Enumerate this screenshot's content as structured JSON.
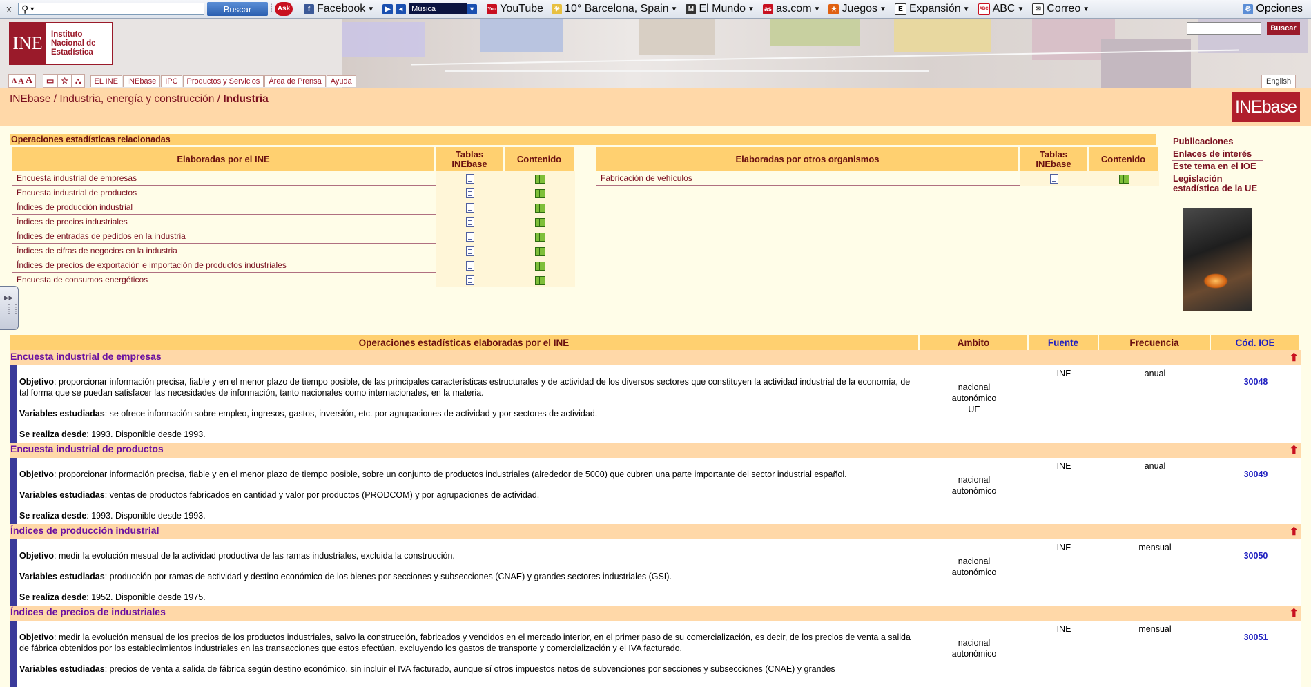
{
  "browser_toolbar": {
    "close": "x",
    "search_button": "Buscar",
    "items": [
      {
        "label": "Facebook",
        "icon": "facebook-icon"
      },
      {
        "label": "Música",
        "icon": "music-icon"
      },
      {
        "label": "YouTube",
        "icon": "youtube-icon"
      },
      {
        "label": "10° Barcelona, Spain",
        "icon": "weather-icon"
      },
      {
        "label": "El Mundo",
        "icon": "news-icon"
      },
      {
        "label": "as.com",
        "icon": "sports-icon"
      },
      {
        "label": "Juegos",
        "icon": "games-icon"
      },
      {
        "label": "Expansión",
        "icon": "expansion-icon"
      },
      {
        "label": "ABC",
        "icon": "abc-icon"
      },
      {
        "label": "Correo",
        "icon": "mail-icon"
      }
    ],
    "options": "Opciones"
  },
  "header": {
    "logo_mark": "INE",
    "logo_lines": [
      "Instituto",
      "Nacional de",
      "Estadística"
    ],
    "search_button": "Buscar",
    "text_size": [
      "A",
      "A",
      "A"
    ],
    "nav": [
      "EL INE",
      "INEbase",
      "IPC",
      "Productos y Servicios",
      "Área de Prensa",
      "Ayuda"
    ],
    "english": "English"
  },
  "breadcrumb": {
    "part1": "INEbase",
    "sep": " / ",
    "part2": "Industria, energía y construcción",
    "current": "Industria",
    "badge_main": "INE",
    "badge_sub": "base"
  },
  "related": {
    "title": "Operaciones estadísticas relacionadas",
    "ine_header": "Elaboradas por el INE",
    "tablas_header_1": "Tablas",
    "tablas_header_2": "INEbase",
    "contenido_header": "Contenido",
    "ine_items": [
      "Encuesta industrial de empresas",
      "Encuesta industrial de productos",
      "Índices de producción industrial",
      "Índices de precios industriales",
      "Índices de entradas de pedidos en la industria",
      "Índices de cifras de negocios en la industria",
      "Índices de precios de exportación e importación de productos industriales",
      "Encuesta de consumos energéticos"
    ],
    "other_header": "Elaboradas por otros organismos",
    "other_items": [
      "Fabricación de vehículos"
    ]
  },
  "side_links": [
    "Publicaciones",
    "Enlaces de interés",
    "Este tema en el IOE",
    "Legislación estadística de la UE"
  ],
  "main_table": {
    "headers": {
      "op": "Operaciones estadísticas elaboradas por el INE",
      "ambito": "Ambito",
      "fuente": "Fuente",
      "frecuencia": "Frecuencia",
      "codigo": "Cód. IOE"
    },
    "labels": {
      "objetivo": "Objetivo",
      "variables": "Variables estudiadas",
      "desde": "Se realiza desde"
    },
    "operations": [
      {
        "title": "Encuesta industrial de empresas",
        "objetivo": ": proporcionar información precisa, fiable y en el menor plazo de tiempo posible, de las principales características estructurales y de actividad de los diversos sectores que constituyen la actividad industrial de la economía, de tal forma que se puedan satisfacer las necesidades de información, tanto nacionales como internacionales, en la materia.",
        "variables": ": se ofrece información sobre empleo, ingresos, gastos, inversión, etc. por agrupaciones de actividad y por sectores de actividad.",
        "desde": ": 1993. Disponible desde 1993.",
        "ambito": [
          "nacional",
          "autonómico",
          "UE"
        ],
        "fuente": "INE",
        "frecuencia": "anual",
        "codigo": "30048"
      },
      {
        "title": "Encuesta industrial de productos",
        "objetivo": ": proporcionar información precisa, fiable y en el menor plazo de tiempo posible, sobre un conjunto de productos industriales (alrededor de 5000) que cubren una parte importante del sector industrial español.",
        "variables": ": ventas de productos fabricados en cantidad y valor por productos (PRODCOM) y por agrupaciones de actividad.",
        "desde": ": 1993. Disponible desde 1993.",
        "ambito": [
          "nacional",
          "autonómico"
        ],
        "fuente": "INE",
        "frecuencia": "anual",
        "codigo": "30049"
      },
      {
        "title": "Índices de producción industrial",
        "objetivo": ": medir la evolución mesual de la actividad productiva de las ramas industriales, excluida la construcción.",
        "variables": ": producción por ramas de actividad y destino económico de los bienes por secciones y subsecciones (CNAE) y grandes sectores industriales (GSI).",
        "desde": ": 1952. Disponible desde 1975.",
        "ambito": [
          "nacional",
          "autonómico"
        ],
        "fuente": "INE",
        "frecuencia": "mensual",
        "codigo": "30050"
      },
      {
        "title": "Índices de precios de industriales",
        "objetivo": ": medir la evolución mensual de los precios de los productos industriales, salvo la construcción, fabricados y vendidos en el mercado interior, en el primer paso de su comercialización, es decir, de los precios de venta a salida de fábrica obtenidos por los establecimientos industriales en las transacciones que estos efectúan, excluyendo los gastos de transporte y comercialización y el IVA facturado.",
        "variables": ": precios de venta a salida de fábrica según destino económico, sin incluir el IVA facturado, aunque sí otros impuestos netos de subvenciones por secciones y subsecciones (CNAE) y grandes",
        "desde": "",
        "ambito": [
          "nacional",
          "autonómico"
        ],
        "fuente": "INE",
        "frecuencia": "mensual",
        "codigo": "30051"
      }
    ]
  },
  "colors": {
    "ine_red": "#9a1a2a",
    "header_orange": "#ffd070",
    "crumb_peach": "#ffd8a8",
    "page_bg": "#fffde8"
  }
}
